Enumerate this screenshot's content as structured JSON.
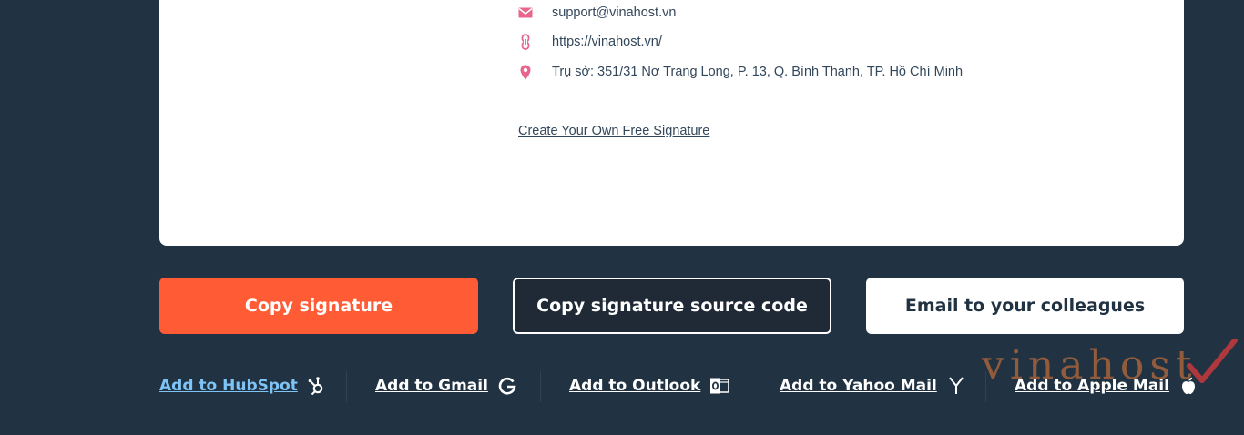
{
  "signature": {
    "email": "support@vinahost.vn",
    "website": "https://vinahost.vn/",
    "address": "Trụ sở: 351/31 Nơ Trang Long, P. 13, Q. Bình Thạnh, TP. Hồ Chí Minh",
    "create_link": "Create Your Own Free Signature"
  },
  "buttons": {
    "copy_signature": "Copy signature",
    "copy_source": "Copy signature source code",
    "email_colleagues": "Email to your colleagues"
  },
  "integrations": [
    {
      "label": "Add to HubSpot",
      "icon": "hubspot-icon"
    },
    {
      "label": "Add to Gmail",
      "icon": "gmail-icon"
    },
    {
      "label": "Add to Outlook",
      "icon": "outlook-icon"
    },
    {
      "label": "Add to Yahoo Mail",
      "icon": "yahoo-icon"
    },
    {
      "label": "Add to Apple Mail",
      "icon": "apple-icon"
    }
  ],
  "watermark": "vinahost",
  "colors": {
    "background": "#213343",
    "accent": "#ff5c35",
    "icon_pink": "#e8668c",
    "link_blue": "#7fc4f5"
  }
}
